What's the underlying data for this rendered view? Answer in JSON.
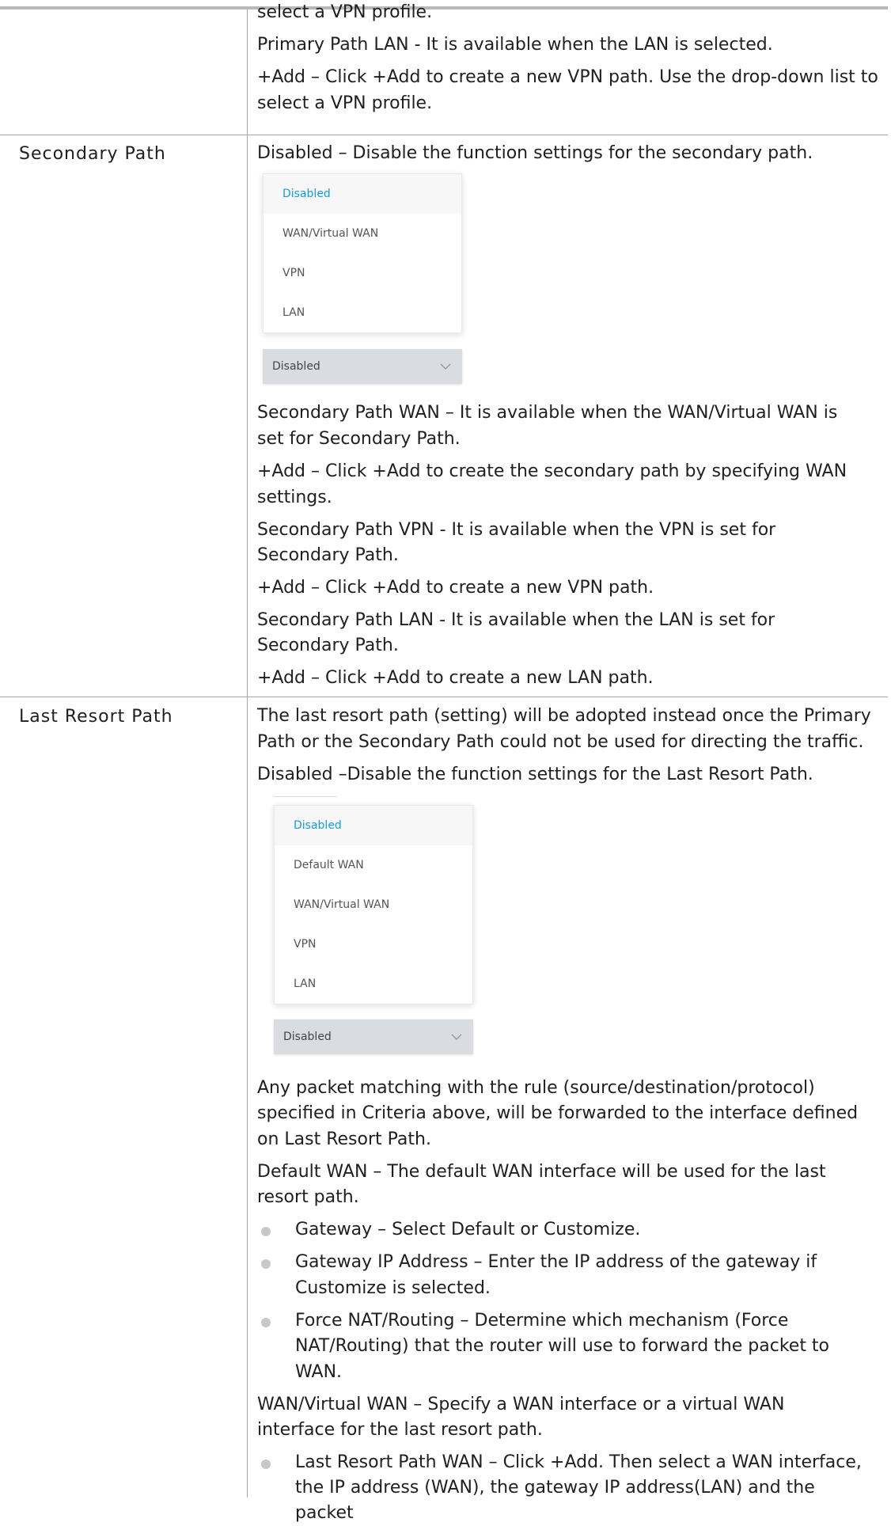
{
  "rows": {
    "top": {
      "lines": [
        "select a VPN profile.",
        "Primary Path LAN - It is available when the LAN is selected.",
        "+Add – Click +Add to create a new VPN path. Use the drop-down list to",
        "select a VPN profile."
      ]
    },
    "secondary": {
      "label": "Secondary Path",
      "intro": "Disabled – Disable the function settings for the secondary path.",
      "dropdown": {
        "options": [
          "Disabled",
          "WAN/Virtual WAN",
          "VPN",
          "LAN"
        ],
        "selected": "Disabled",
        "selected_color": "#1a9bd7"
      },
      "lines": [
        "Secondary Path WAN – It is available when the WAN/Virtual WAN is",
        "set for Secondary Path.",
        "+Add – Click +Add to create the secondary path by specifying WAN",
        "settings.",
        "Secondary Path VPN - It is available when the VPN is set for",
        "Secondary Path.",
        "+Add – Click +Add to create a new VPN path.",
        "Secondary Path LAN - It is available when the LAN is set for",
        "Secondary Path.",
        "+Add – Click +Add to create a new LAN path."
      ]
    },
    "last_resort": {
      "label": "Last Resort Path",
      "intro": [
        "The last resort path (setting) will be adopted instead once the Primary",
        "Path or the Secondary Path could not be used for directing the traffic.",
        "Disabled –Disable the function settings for the Last Resort Path."
      ],
      "dropdown": {
        "options": [
          "Disabled",
          "Default WAN",
          "WAN/Virtual WAN",
          "VPN",
          "LAN"
        ],
        "selected": "Disabled",
        "selected_color": "#1a9bd7"
      },
      "lines": [
        "Any packet matching with the rule (source/destination/protocol)",
        "specified in Criteria above, will be forwarded to the interface defined",
        "on Last Resort Path.",
        "Default WAN – The default WAN interface will be used for the last",
        "resort path."
      ],
      "bullets1": [
        [
          "Gateway – Select Default or Customize."
        ],
        [
          "Gateway IP Address – Enter the IP address of the gateway if",
          "Customize is selected."
        ],
        [
          "Force NAT/Routing – Determine which mechanism (Force",
          "NAT/Routing) that the router will use to forward the packet to",
          "WAN."
        ]
      ],
      "lines2": [
        "WAN/Virtual WAN – Specify a WAN interface or a virtual WAN",
        "interface for the last resort path."
      ],
      "bullets2": [
        [
          "Last Resort Path WAN – Click +Add. Then select a WAN interface,",
          "the IP address (WAN), the gateway IP address(LAN) and the packet"
        ]
      ]
    }
  }
}
